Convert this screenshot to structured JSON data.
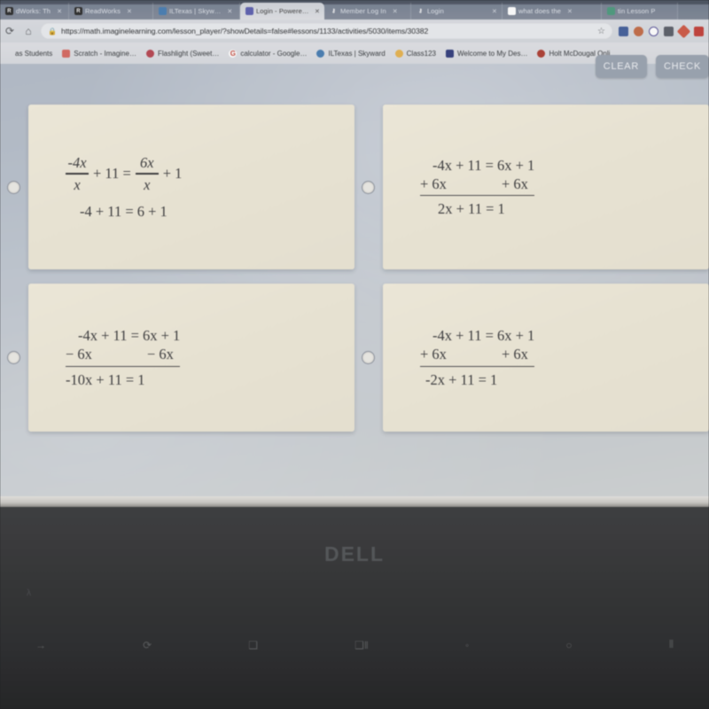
{
  "browser": {
    "tabs": [
      {
        "label": "dWorks: Th",
        "icon": "readworks-icon",
        "active": false
      },
      {
        "label": "ReadWorks",
        "icon": "readworks-icon",
        "active": false
      },
      {
        "label": "ILTexas | Skyw…",
        "icon": "iltexas-icon",
        "active": false
      },
      {
        "label": "Login - Powere…",
        "icon": "pearson-icon",
        "active": true
      },
      {
        "label": "Member Log In",
        "icon": "member-icon",
        "active": false
      },
      {
        "label": "Login",
        "icon": "login-icon",
        "active": false
      },
      {
        "label": "what does the",
        "icon": "google-icon",
        "active": false
      },
      {
        "label": "tin Lesson P",
        "icon": "lesson-icon",
        "active": false
      }
    ],
    "nav": {
      "reload_icon": "reload-icon",
      "home_icon": "home-icon",
      "lock_icon": "lock-icon",
      "star_icon": "star-icon",
      "url": "https://math.imaginelearning.com/lesson_player/?showDetails=false#lessons/1133/activities/5030/items/30382"
    },
    "extensions": [
      "extension-blue-icon",
      "extension-orange-icon",
      "extension-circle-icon",
      "extension-grid-icon",
      "extension-diamond-icon",
      "extension-red-icon"
    ],
    "bookmarks": [
      {
        "label": "as Students",
        "icon": "bookmark-icon"
      },
      {
        "label": "Scratch - Imagine…",
        "icon": "scratch-icon"
      },
      {
        "label": "Flashlight (Sweet…",
        "icon": "flashlight-icon"
      },
      {
        "label": "calculator - Google…",
        "icon": "google-icon"
      },
      {
        "label": "ILTexas | Skyward",
        "icon": "iltexas-icon"
      },
      {
        "label": "Class123",
        "icon": "class123-icon"
      },
      {
        "label": "Welcome to My Des…",
        "icon": "welcome-icon"
      },
      {
        "label": "Holt McDougal Onli…",
        "icon": "holt-icon"
      }
    ]
  },
  "activity": {
    "actions": {
      "clear_label": "CLEAR",
      "check_label": "CHECK"
    },
    "options": [
      {
        "name": "option-a",
        "layout": "fraction",
        "selected": false,
        "line1": {
          "lead": "",
          "frac1_num": "-4x",
          "frac1_den": "x",
          "mid": "+ 11 =",
          "frac2_num": "6x",
          "frac2_den": "x",
          "tail": "+ 1"
        },
        "line2": "-4 + 11 = 6 + 1"
      },
      {
        "name": "option-b",
        "layout": "vertical",
        "selected": false,
        "line1": "-4x + 11 = 6x + 1",
        "line2_left": "+ 6x",
        "line2_right": "+ 6x",
        "line3": "2x + 11 = 1"
      },
      {
        "name": "option-c",
        "layout": "vertical",
        "selected": false,
        "line1": "-4x + 11 = 6x + 1",
        "line2_left": "− 6x",
        "line2_right": "− 6x",
        "line3": "-10x + 11 = 1"
      },
      {
        "name": "option-d",
        "layout": "vertical",
        "selected": false,
        "line1": "-4x + 11 = 6x + 1",
        "line2_left": "+ 6x",
        "line2_right": "+ 6x",
        "line3": "-2x + 11 = 1"
      }
    ]
  },
  "laptop": {
    "brand": "DELL",
    "fn_keys": [
      "→",
      "⟳",
      "❑",
      "❑‖",
      "◦",
      "○",
      "⦀"
    ],
    "key_hint": "λ"
  },
  "colors": {
    "page_background": "#b8c2cf",
    "card_background": "#efe8d4",
    "math_text": "#3a3a3c",
    "button_background": "#98a3b3",
    "laptop_body": "#313234"
  }
}
